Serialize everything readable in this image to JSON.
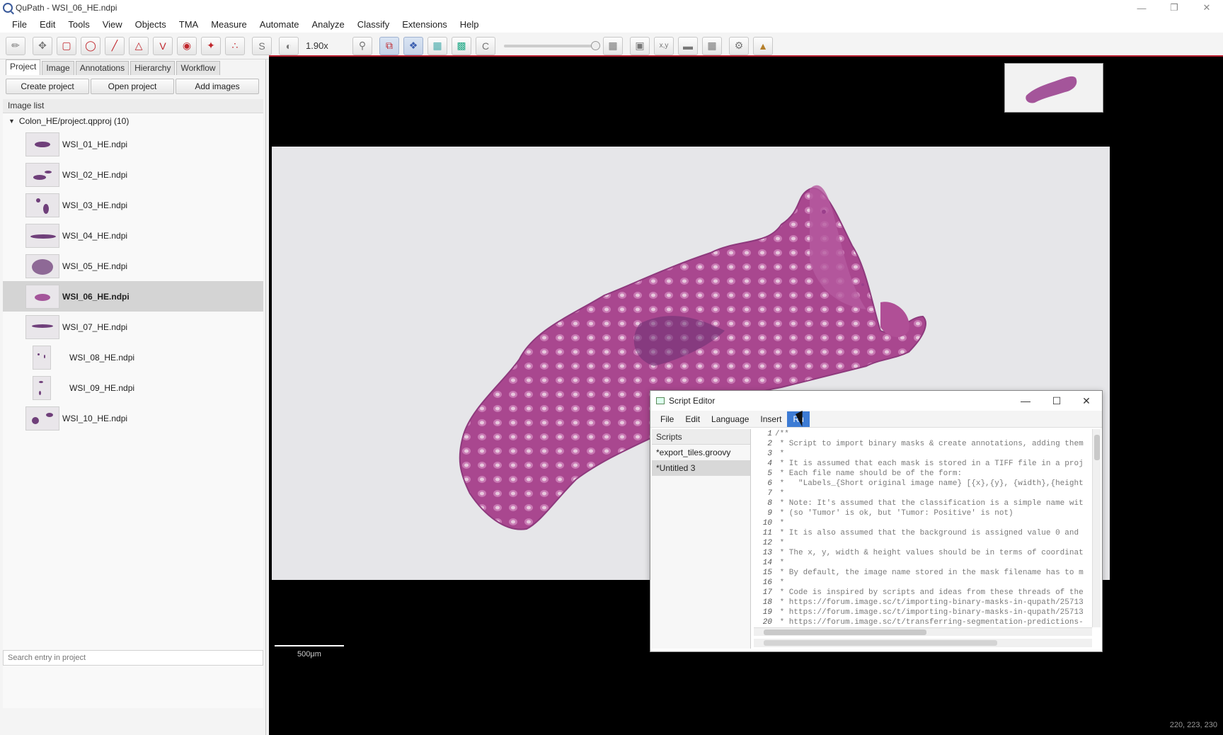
{
  "window": {
    "title": "QuPath - WSI_06_HE.ndpi"
  },
  "menubar": [
    "File",
    "Edit",
    "Tools",
    "View",
    "Objects",
    "TMA",
    "Measure",
    "Automate",
    "Analyze",
    "Classify",
    "Extensions",
    "Help"
  ],
  "toolbar": {
    "zoom": "1.90x",
    "tools": [
      "pin-icon",
      "move-icon",
      "rectangle-icon",
      "ellipse-icon",
      "line-icon",
      "polygon-icon",
      "polyline-icon",
      "brush-icon",
      "wand-icon",
      "points-icon",
      "selection-mode-icon",
      "brightness-contrast-icon"
    ]
  },
  "left_panel": {
    "tabs": [
      "Project",
      "Image",
      "Annotations",
      "Hierarchy",
      "Workflow"
    ],
    "buttons": [
      "Create project",
      "Open project",
      "Add images"
    ],
    "image_list_header": "Image list",
    "project_root": "Colon_HE/project.qpproj (10)",
    "images": [
      "WSI_01_HE.ndpi",
      "WSI_02_HE.ndpi",
      "WSI_03_HE.ndpi",
      "WSI_04_HE.ndpi",
      "WSI_05_HE.ndpi",
      "WSI_06_HE.ndpi",
      "WSI_07_HE.ndpi",
      "WSI_08_HE.ndpi",
      "WSI_09_HE.ndpi",
      "WSI_10_HE.ndpi"
    ],
    "selected_image": "WSI_06_HE.ndpi",
    "search_placeholder": "Search entry in project"
  },
  "viewer": {
    "scalebar_label": "500μm",
    "coords_label": "220, 223, 230"
  },
  "script_editor": {
    "title": "Script Editor",
    "menus": [
      "File",
      "Edit",
      "Language",
      "Insert",
      "Ru"
    ],
    "scripts_header": "Scripts",
    "scripts": [
      "*export_tiles.groovy",
      "*Untitled 3"
    ],
    "code_lines": [
      {
        "n": "1",
        "t": "/**"
      },
      {
        "n": "2",
        "t": " * Script to import binary masks & create annotations, adding them"
      },
      {
        "n": "3",
        "t": " *"
      },
      {
        "n": "4",
        "t": " * It is assumed that each mask is stored in a TIFF file in a proj"
      },
      {
        "n": "5",
        "t": " * Each file name should be of the form:"
      },
      {
        "n": "6",
        "t": " *   \"Labels_{Short original image name} [{x},{y}, {width},{height"
      },
      {
        "n": "7",
        "t": " *"
      },
      {
        "n": "8",
        "t": " * Note: It's assumed that the classification is a simple name wit"
      },
      {
        "n": "9",
        "t": " * (so 'Tumor' is ok, but 'Tumor: Positive' is not)"
      },
      {
        "n": "10",
        "t": " *"
      },
      {
        "n": "11",
        "t": " * It is also assumed that the background is assigned value 0 and"
      },
      {
        "n": "12",
        "t": " *"
      },
      {
        "n": "13",
        "t": " * The x, y, width & height values should be in terms of coordinat"
      },
      {
        "n": "14",
        "t": " *"
      },
      {
        "n": "15",
        "t": " * By default, the image name stored in the mask filename has to m"
      },
      {
        "n": "16",
        "t": " *"
      },
      {
        "n": "17",
        "t": " * Code is inspired by scripts and ideas from these threads of the"
      },
      {
        "n": "18",
        "t": " * https://forum.image.sc/t/importing-binary-masks-in-qupath/25713"
      },
      {
        "n": "19",
        "t": " * https://forum.image.sc/t/importing-binary-masks-in-qupath/25713"
      },
      {
        "n": "20",
        "t": " * https://forum.image.sc/t/transferring-segmentation-predictions-"
      }
    ]
  },
  "colors": {
    "tissue": "#9b3f8c",
    "slide_background": "#e6e6e9",
    "viewer_background": "#000000",
    "active_menu": "#3c7bd4"
  }
}
